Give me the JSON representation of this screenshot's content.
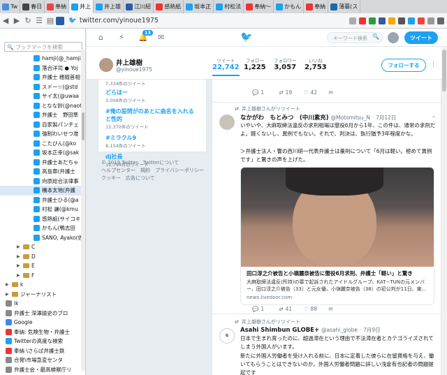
{
  "tabs": [
    {
      "label": "Tw",
      "color": "#4a90e2"
    },
    {
      "label": "春日",
      "color": "#444"
    },
    {
      "label": "奉納",
      "color": "#e44"
    },
    {
      "label": "井上",
      "color": "#1da1f2",
      "active": true
    },
    {
      "label": "井上雄",
      "color": "#1da1f2"
    },
    {
      "label": "江川紹",
      "color": "#2a5caa"
    },
    {
      "label": "感熱紙",
      "color": "#e33"
    },
    {
      "label": "坂本正",
      "color": "#1da1f2"
    },
    {
      "label": "村松法",
      "color": "#1da1f2"
    },
    {
      "label": "奉納〜",
      "color": "#e33"
    },
    {
      "label": "かもん",
      "color": "#1da1f2"
    },
    {
      "label": "奉納",
      "color": "#e33"
    },
    {
      "label": "薄暮(ス",
      "color": "#1a6ca8"
    }
  ],
  "address": {
    "url": "twitter.com/yinoue1975"
  },
  "sidebar": {
    "search_placeholder": "ブックマークを検索",
    "items": [
      {
        "label": "hamji(@_hamji)",
        "icon": "#1da1f2",
        "type": "bm"
      },
      {
        "label": "落合洋司 ● Yoj",
        "icon": "#1da1f2",
        "type": "bm"
      },
      {
        "label": "弁護士 穂随首相",
        "icon": "#1da1f2",
        "type": "bm"
      },
      {
        "label": "スドー☆(@std",
        "icon": "#1da1f2",
        "type": "bm"
      },
      {
        "label": "サイ太(@uwaa",
        "icon": "#1da1f2",
        "type": "bm"
      },
      {
        "label": "となな鈴(@naot",
        "icon": "#1da1f2",
        "type": "bm"
      },
      {
        "label": "弁護士　野田隼",
        "icon": "#1da1f2",
        "type": "bm"
      },
      {
        "label": "自家製パンチェ",
        "icon": "#1da1f2",
        "type": "bm"
      },
      {
        "label": "強制わいせつ准",
        "icon": "#1da1f2",
        "type": "bm"
      },
      {
        "label": "こたびん(@ko",
        "icon": "#1da1f2",
        "type": "bm"
      },
      {
        "label": "坂本正幸(@sak",
        "icon": "#1da1f2",
        "type": "bm"
      },
      {
        "label": "弁護士あだちゃ",
        "icon": "#1da1f2",
        "type": "bm"
      },
      {
        "label": "高島章(弁護士",
        "icon": "#1da1f2",
        "type": "bm"
      },
      {
        "label": "向原総合法律事",
        "icon": "#1da1f2",
        "type": "bm"
      },
      {
        "label": "橋本太地(弁護",
        "icon": "#1da1f2",
        "type": "bm",
        "sel": true
      },
      {
        "label": "弁護士ひる(@a",
        "icon": "#1da1f2",
        "type": "bm"
      },
      {
        "label": "村松 謙(@kmu",
        "icon": "#1da1f2",
        "type": "bm"
      },
      {
        "label": "感熱紙(サイコキ",
        "icon": "#1da1f2",
        "type": "bm"
      },
      {
        "label": "かもん(鴨志田",
        "icon": "#1da1f2",
        "type": "bm"
      },
      {
        "label": "SANO, Ayako(佐",
        "icon": "#1da1f2",
        "type": "bm"
      },
      {
        "label": "C",
        "type": "folder"
      },
      {
        "label": "D",
        "type": "folder"
      },
      {
        "label": "E",
        "type": "folder"
      },
      {
        "label": "F",
        "type": "folder"
      },
      {
        "label": "k",
        "type": "folder",
        "root": true
      },
      {
        "label": "ジャーナリスト",
        "type": "folder",
        "root": true
      },
      {
        "label": "lk",
        "icon": "#888",
        "type": "bm",
        "root": true
      },
      {
        "label": "弁護士 深澤諭史のブロ",
        "icon": "#888",
        "type": "bm",
        "root": true
      },
      {
        "label": "Google",
        "icon": "#4285f4",
        "type": "bm",
        "root": true
      },
      {
        "label": "奉納: 危険生物・弁護士",
        "icon": "#e33",
        "type": "bm",
        "root": true
      },
      {
        "label": "Twitterの高度な検索",
        "icon": "#1da1f2",
        "type": "bm",
        "root": true
      },
      {
        "label": "奉納 \\さらば弁護士鉄",
        "icon": "#e33",
        "type": "bm",
        "root": true
      },
      {
        "label": "合発\\市場急変センタ",
        "icon": "#888",
        "type": "bm",
        "root": true
      },
      {
        "label": "弁護士会・最高検察庁リ",
        "icon": "#888",
        "type": "bm",
        "root": true
      }
    ]
  },
  "twitter_nav": {
    "notif_count": "13",
    "search_placeholder": "キーワード検索",
    "tweet_button": "ツイート"
  },
  "profile": {
    "name": "井上雄樹",
    "handle": "@yinoue1975",
    "stats": [
      {
        "label": "ツイート",
        "value": "22,742",
        "active": true
      },
      {
        "label": "フォロー",
        "value": "1,225"
      },
      {
        "label": "フォロワー",
        "value": "3,057"
      },
      {
        "label": "いいね",
        "value": "2,753"
      }
    ],
    "follow_button": "フォローする"
  },
  "trends": [
    {
      "name": "",
      "count": "7,334件のツイート"
    },
    {
      "name": "どらほー",
      "count": "3,008件のツイート"
    },
    {
      "name": "#俺の設問がのあとに曲名を入れると性的",
      "count": "15,370件のツイート"
    },
    {
      "name": "#ミラクル9",
      "count": "8,154件のツイート"
    },
    {
      "name": "dj社長",
      "count": "12,794件のツイート"
    }
  ],
  "footer": {
    "line1": "© 2019 Twitter　Twitterについて",
    "line2": "ヘルプセンター　規約　プライバシーポリシー",
    "line3": "クッキー　広告について"
  },
  "tweets": [
    {
      "actions": {
        "reply": "1",
        "retweet": "19",
        "like": "42"
      }
    },
    {
      "rt_by": "井上雄樹さんがリツイート",
      "name": "なかがわ　もとみつ　(中川素充)",
      "handle": "@Motomitsu_N",
      "date": "7月12日",
      "text": "いやいや、大麻取締法違反の求刑相場は懲役6月から1年、この件は、通常の求刑だよ。軽くないし、異例でもない。それで、判決は、執行猶予3年程度かな。",
      "text2": "＞弁護士法人・響の西川研一代表弁護士は量刑について「6月は軽い。極めて異例です」と驚きの声を上げた。",
      "card_title": "田口淳之介被告と小嶺麗奈被告に懲役6月求刑、弁護士「軽い」と驚き",
      "card_desc": "大麻取締法違反(所持)の罪で起訴されたアイドルグループ、KAT−TUNの元メンバー、田口淳之介被告（33）と元女優、小嶺麗奈被告（38）の初公判が11日、東...",
      "card_domain": "news.livedoor.com",
      "actions": {
        "reply": "1",
        "retweet": "41",
        "like": "88"
      }
    },
    {
      "rt_by": "井上雄樹さんがリツイート",
      "name": "Asahi Shimbun GLOBE+",
      "handle": "@asahi_globe",
      "date": "7月9日",
      "text": "日本で生まれ育ったのに、超過滞在という理由で不法滞在者とカテゴライズされてしまう外国人がいます。",
      "text2": "新たに外国人労働者を受け入れる前に、日本に定着した彼らに在留資格を与え、働いてもらうことはできないのか。外国人労働者問題に詳しい浅倉有也記者の問題提起です"
    }
  ]
}
